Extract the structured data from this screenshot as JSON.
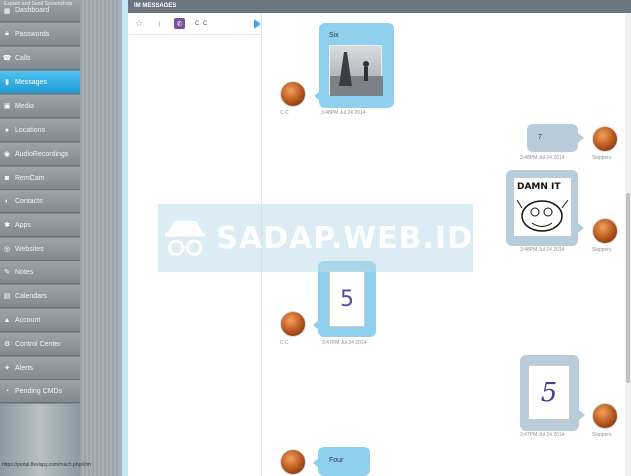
{
  "sidebar": {
    "top_label": "Explain and Send Screenshots",
    "items": [
      {
        "label": "Dashboard",
        "icon": "dashboard-icon"
      },
      {
        "label": "Passwords",
        "icon": "lock-icon"
      },
      {
        "label": "Calls",
        "icon": "phone-icon"
      },
      {
        "label": "Messages",
        "icon": "message-icon"
      },
      {
        "label": "Media",
        "icon": "image-icon"
      },
      {
        "label": "Locations",
        "icon": "location-icon"
      },
      {
        "label": "AudioRecordings",
        "icon": "microphone-icon"
      },
      {
        "label": "RemCam",
        "icon": "camera-icon"
      },
      {
        "label": "Contacts",
        "icon": "contacts-icon"
      },
      {
        "label": "Apps",
        "icon": "apps-icon"
      },
      {
        "label": "Websites",
        "icon": "globe-icon"
      },
      {
        "label": "Notes",
        "icon": "pencil-icon"
      },
      {
        "label": "Calendars",
        "icon": "calendar-icon"
      },
      {
        "label": "Account",
        "icon": "user-icon"
      },
      {
        "label": "Control Center",
        "icon": "settings-icon"
      },
      {
        "label": "Alerts",
        "icon": "alert-icon"
      },
      {
        "label": "Pending CMDs",
        "icon": "pending-icon"
      }
    ],
    "active": "Messages"
  },
  "status_url": "https://portal.flexispy.com/mach.php#/im",
  "panel": {
    "title": "IM MESSAGES",
    "thread": {
      "name": "C C",
      "app_icon": "viber-icon"
    }
  },
  "messages": [
    {
      "direction": "in",
      "sender": "C C",
      "text": "Six",
      "has_image": true,
      "time": "3:48PM Jul 24 2014"
    },
    {
      "direction": "out",
      "sender": "Skippers",
      "text": "7",
      "has_image": false,
      "time": "3:48PM Jul 24 2014"
    },
    {
      "direction": "out",
      "sender": "Skippers",
      "text": "DAMN IT",
      "has_image": true,
      "time": "3:48PM Jul 24 2014"
    },
    {
      "direction": "in",
      "sender": "C C",
      "text": "5",
      "has_image": true,
      "time": "3:47PM Jul 24 2014"
    },
    {
      "direction": "out",
      "sender": "Skippers",
      "text": "5",
      "has_image": true,
      "time": "3:47PM Jul 24 2014"
    },
    {
      "direction": "in",
      "sender": "C C",
      "text": "Four",
      "has_image": false,
      "time": ""
    }
  ],
  "watermark": "SADAP.WEB.ID",
  "colors": {
    "accent": "#1f9bd6",
    "incoming_bubble": "#8fd0ee",
    "outgoing_bubble": "#b9ccd9",
    "header": "#6b7680"
  }
}
